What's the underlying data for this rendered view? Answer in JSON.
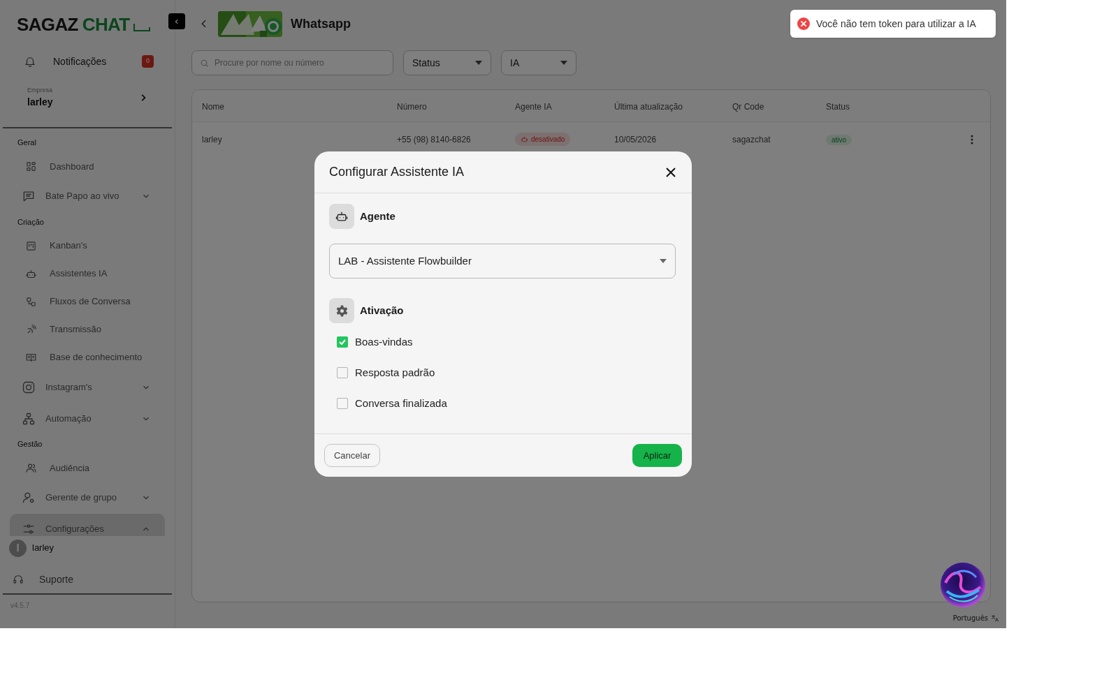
{
  "sidebar": {
    "logo": {
      "dark": "SAGAZ",
      "accent": "CHAT"
    },
    "notifications": {
      "label": "Notificações",
      "count": "0"
    },
    "company": {
      "caption": "Empresa",
      "name": "larley"
    },
    "sections": [
      {
        "title": "Geral",
        "items": [
          {
            "label": "Dashboard",
            "kind": "link",
            "selected": false
          },
          {
            "label": "Bate Papo ao vivo",
            "kind": "group",
            "expanded": false,
            "selected": false
          }
        ]
      },
      {
        "title": "Criação",
        "items": [
          {
            "label": "Kanban's",
            "kind": "link",
            "selected": false
          },
          {
            "label": "Assistentes IA",
            "kind": "link",
            "selected": false
          },
          {
            "label": "Fluxos de Conversa",
            "kind": "link",
            "selected": false
          },
          {
            "label": "Transmissão",
            "kind": "link",
            "selected": false
          },
          {
            "label": "Base de conhecimento",
            "kind": "link",
            "selected": false
          },
          {
            "label": "Instagram's",
            "kind": "group",
            "expanded": false,
            "selected": false
          },
          {
            "label": "Automação",
            "kind": "group",
            "expanded": false,
            "selected": false
          }
        ]
      },
      {
        "title": "Gestão",
        "items": [
          {
            "label": "Audiência",
            "kind": "link",
            "selected": false
          },
          {
            "label": "Gerente de grupo",
            "kind": "group",
            "expanded": false,
            "selected": false
          },
          {
            "label": "Configurações",
            "kind": "group",
            "expanded": true,
            "selected": true
          }
        ]
      }
    ],
    "user": {
      "initial": "l",
      "name": "larley"
    },
    "support": "Suporte",
    "version": "v4.5.7"
  },
  "header": {
    "title": "Whatsapp"
  },
  "filters": {
    "search": {
      "placeholder": "Procure por nome ou número"
    },
    "dropdowns": [
      "Status",
      "IA"
    ]
  },
  "table": {
    "columns": [
      "Nome",
      "Número",
      "Agente IA",
      "Última atualização",
      "Qr Code",
      "Status"
    ],
    "rows": [
      {
        "name": "larley",
        "number": "+55 (98) 8140-6826",
        "agent": {
          "label": "desativado",
          "active": false
        },
        "updated": "10/05/2026",
        "qr_code": "sagazchat",
        "status": {
          "label": "ativo",
          "active": true
        }
      }
    ]
  },
  "modal": {
    "title": "Configurar Assistente IA",
    "agent_section": {
      "title": "Agente",
      "value": "LAB - Assistente Flowbuilder"
    },
    "activation_section": {
      "title": "Ativação",
      "options": [
        {
          "label": "Boas-vindas",
          "checked": true
        },
        {
          "label": "Resposta padrão",
          "checked": false
        },
        {
          "label": "Conversa finalizada",
          "checked": false
        }
      ]
    },
    "buttons": {
      "cancel": "Cancelar",
      "apply": "Aplicar"
    }
  },
  "toast": {
    "message": "Você não tem token para utilizar a IA"
  },
  "language": "Português"
}
